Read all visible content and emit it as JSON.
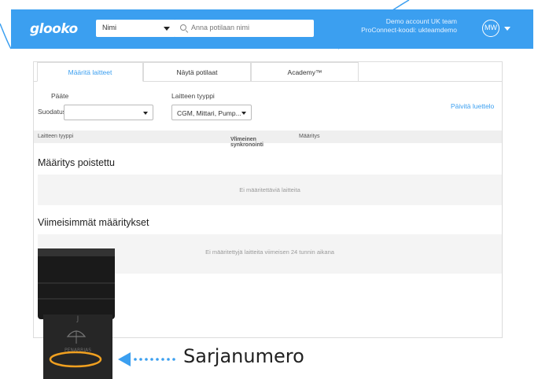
{
  "header": {
    "logo": "glooko",
    "name_select": "Nimi",
    "search_placeholder": "Anna potilaan nimi",
    "account_line1": "Demo account UK team",
    "account_line2": "ProConnect-koodi: ukteamdemo",
    "avatar_initials": "MW"
  },
  "tabs": [
    {
      "label": "Määritä laitteet",
      "active": true
    },
    {
      "label": "Näytä potilaat",
      "active": false
    },
    {
      "label": "Academy™",
      "active": false
    }
  ],
  "filters": {
    "label": "Suodatus",
    "device_label": "Pääte",
    "device_value": "",
    "type_label": "Laitteen tyyppi",
    "type_value": "CGM, Mittari, Pump..."
  },
  "refresh_link": "Päivitä luettelo",
  "table": {
    "columns": [
      "Laitteen tyyppi",
      "Viimeinen synkronointi",
      "Määritys"
    ]
  },
  "sections": [
    {
      "title": "Määritys poistettu",
      "empty_message": "Ei määritettäviä laitteita"
    },
    {
      "title": "Viimeisimmät määritykset",
      "empty_message": "Ei määritettyjä laitteita viimeisen 24 tunnin aikana"
    }
  ],
  "overlay": {
    "device_print": "PENARRIAS",
    "serial_label": "Sarjanumero"
  },
  "colors": {
    "brand": "#3b9ff0",
    "highlight": "#f0a020"
  }
}
